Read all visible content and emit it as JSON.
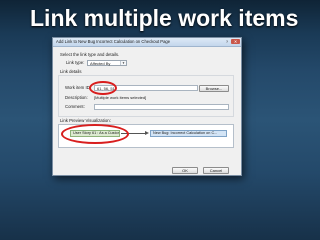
{
  "slide": {
    "title": "Link multiple work items"
  },
  "dialog": {
    "title": "Add Link to New Bug Incorrect Calculation on Checkout Page",
    "help_glyph": "?",
    "close_glyph": "✕",
    "instruction": "Select the link type and details.",
    "link_type_label": "Link type:",
    "link_type_value": "Affected By",
    "link_details_label": "Link details",
    "work_items_label": "Work item ID:",
    "work_items_value": "61, 56, 51",
    "browse_label": "Browse...",
    "description_label": "Description:",
    "description_value": "[Multiple work items selected]",
    "comment_label": "Comment:",
    "comment_value": "",
    "visualization_label": "Link Preview Visualization:",
    "source_node": "User Story 61 : As a Customer I want...",
    "target_node": "New Bug: Incorrect Calculation on C...",
    "ok_label": "OK",
    "cancel_label": "Cancel"
  }
}
